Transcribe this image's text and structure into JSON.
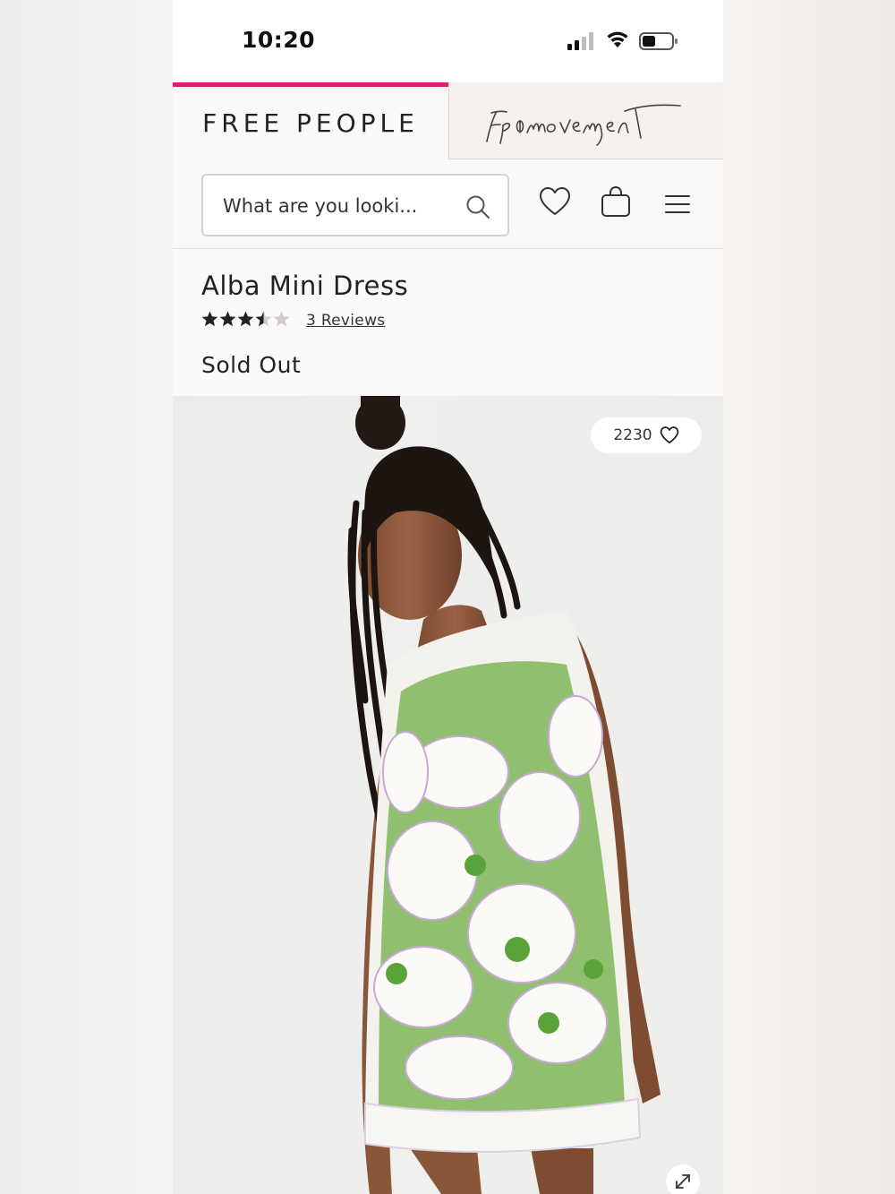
{
  "status_bar": {
    "time": "10:20"
  },
  "brand_tabs": {
    "free_people": "FREE PEOPLE",
    "movement_logo": "fp movement"
  },
  "search": {
    "placeholder": "What are you looki..."
  },
  "product": {
    "title": "Alba Mini Dress",
    "rating": 3.5,
    "rating_max": 5,
    "reviews_label": "3 Reviews",
    "availability": "Sold Out",
    "wishlist_count": "2230"
  },
  "colors": {
    "accent": "#d8226f",
    "text": "#222222"
  },
  "icons": [
    "signal-icon",
    "wifi-icon",
    "battery-icon",
    "search-icon",
    "heart-icon",
    "bag-icon",
    "menu-icon",
    "star-icon",
    "expand-icon"
  ]
}
